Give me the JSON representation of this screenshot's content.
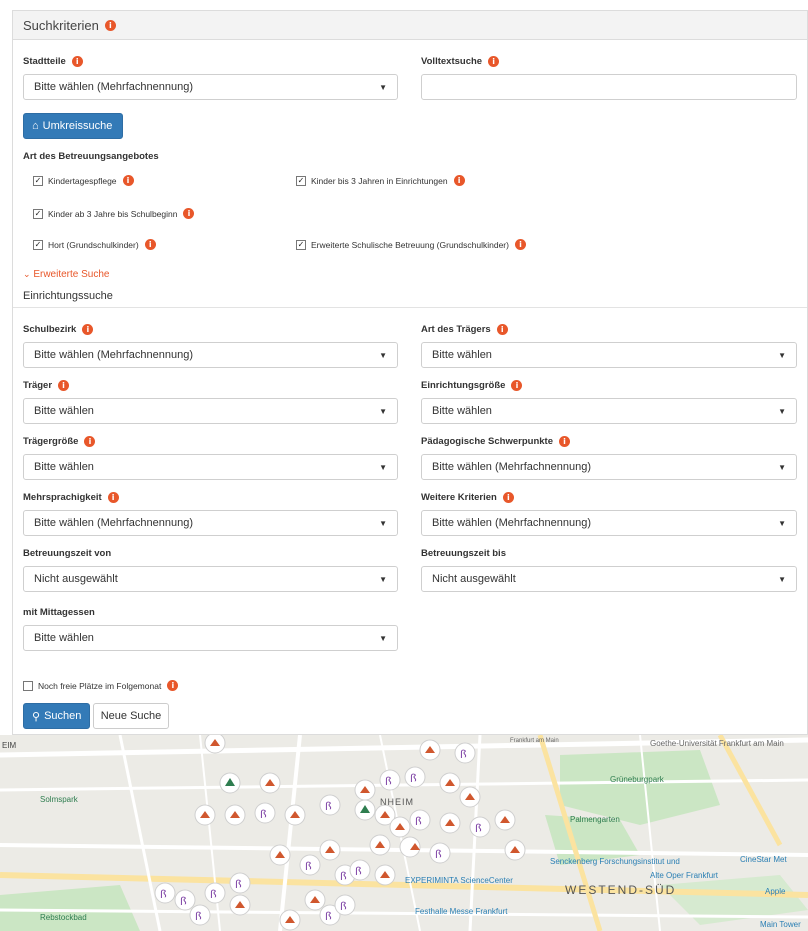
{
  "panel": {
    "title": "Suchkriterien"
  },
  "filters": {
    "stadtteile": {
      "label": "Stadtteile",
      "value": "Bitte wählen (Mehrfachnennung)"
    },
    "volltext": {
      "label": "Volltextsuche",
      "value": ""
    },
    "umkreis_label": "Umkreissuche",
    "art_heading": "Art des Betreuungsangebotes",
    "checkboxes": [
      {
        "label": "Kindertagespflege",
        "checked": true
      },
      {
        "label": "Kinder bis 3 Jahren in Einrichtungen",
        "checked": true
      },
      {
        "label": "Kinder ab 3 Jahre bis Schulbeginn",
        "checked": true
      },
      {
        "label": "Hort (Grundschulkinder)",
        "checked": true
      },
      {
        "label": "Erweiterte Schulische Betreuung (Grundschulkinder)",
        "checked": true
      }
    ],
    "erweiterte_link": "Erweiterte Suche",
    "einrichtung_heading": "Einrichtungssuche"
  },
  "advanced": {
    "schulbezirk": {
      "label": "Schulbezirk",
      "value": "Bitte wählen (Mehrfachnennung)"
    },
    "art_traeger": {
      "label": "Art des Trägers",
      "value": "Bitte wählen"
    },
    "traeger": {
      "label": "Träger",
      "value": "Bitte wählen"
    },
    "einrichtungsgroesse": {
      "label": "Einrichtungsgröße",
      "value": "Bitte wählen"
    },
    "traegergroesse": {
      "label": "Trägergröße",
      "value": "Bitte wählen"
    },
    "paedagogisch": {
      "label": "Pädagogische Schwerpunkte",
      "value": "Bitte wählen (Mehrfachnennung)"
    },
    "mehrsprachigkeit": {
      "label": "Mehrsprachigkeit",
      "value": "Bitte wählen (Mehrfachnennung)"
    },
    "weitere": {
      "label": "Weitere Kriterien",
      "value": "Bitte wählen (Mehrfachnennung)"
    },
    "zeit_von": {
      "label": "Betreuungszeit von",
      "value": "Nicht ausgewählt"
    },
    "zeit_bis": {
      "label": "Betreuungszeit bis",
      "value": "Nicht ausgewählt"
    },
    "mittagessen": {
      "label": "mit Mittagessen",
      "value": "Bitte wählen"
    },
    "freie_plaetze": {
      "label": "Noch freie Plätze im Folgemonat",
      "checked": false
    }
  },
  "actions": {
    "search_label": "Suchen",
    "new_search_label": "Neue Suche"
  },
  "map": {
    "labels": {
      "eim": "EIM",
      "solmspark": "Solmspark",
      "rebstockbad": "Rebstockbad",
      "goethe_uni": "Goethe-Universität Frankfurt am Main",
      "grueneburgpark": "Grüneburgpark",
      "palmengarten": "Palmengarten",
      "senckenberg": "Senckenberg Forschungsinstitut und",
      "alte_oper": "Alte Oper Frankfurt",
      "cinestar": "CineStar Met",
      "experiminta": "EXPERIMINTA ScienceCenter",
      "westend": "WESTEND-SÜD",
      "festhalle": "Festhalle Messe Frankfurt",
      "apple": "Apple",
      "main_tower": "Main Tower",
      "nheim": "NHEIM",
      "frankfurt_am_main": "Frankfurt am Main"
    },
    "colors": {
      "marker_orange": "#d0572e",
      "marker_purple": "#7b3fa3",
      "marker_green": "#2e7d4f",
      "park": "#c8e6c0"
    }
  }
}
